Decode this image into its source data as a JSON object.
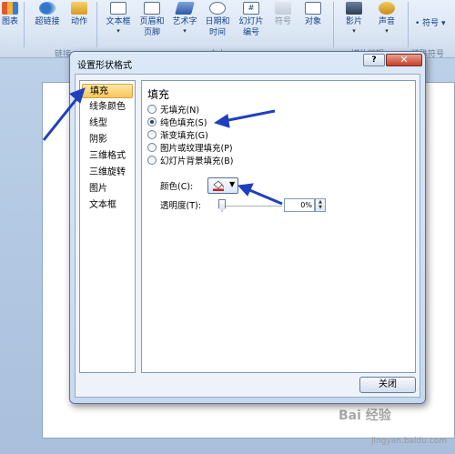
{
  "ribbon": {
    "buttons": [
      {
        "label": "图表"
      },
      {
        "label": "超链接"
      },
      {
        "label": "动作"
      },
      {
        "label": "文本框"
      },
      {
        "label": "页眉和",
        "label2": "页脚"
      },
      {
        "label": "艺术字"
      },
      {
        "label": "日期和",
        "label2": "时间"
      },
      {
        "label": "幻灯片",
        "label2": "编号"
      },
      {
        "label": "符号"
      },
      {
        "label": "对象"
      },
      {
        "label": "影片"
      },
      {
        "label": "声音"
      }
    ],
    "groups": [
      "链接",
      "文本",
      "媒体剪辑",
      "特殊符号"
    ],
    "symbol_label": "符号"
  },
  "dialog": {
    "title": "设置形状格式",
    "help": "?",
    "close_x": "✕",
    "nav_items": [
      "填充",
      "线条颜色",
      "线型",
      "阴影",
      "三维格式",
      "三维旋转",
      "图片",
      "文本框"
    ],
    "selected_nav": "填充",
    "section_title": "填充",
    "fill_options": [
      {
        "label": "无填充(N)",
        "selected": false
      },
      {
        "label": "纯色填充(S)",
        "selected": true
      },
      {
        "label": "渐变填充(G)",
        "selected": false
      },
      {
        "label": "图片或纹理填充(P)",
        "selected": false
      },
      {
        "label": "幻灯片背景填充(B)",
        "selected": false
      }
    ],
    "color_label": "颜色(C):",
    "color_value": "#d02020",
    "transparency_label": "透明度(T):",
    "transparency_value": "0%",
    "close_button": "关闭"
  },
  "watermark": {
    "text": "Bai 经验",
    "sub": "jingyan.baidu.com"
  },
  "colors": {
    "accent": "#1f3fbf",
    "selection": "#f6c65a"
  }
}
